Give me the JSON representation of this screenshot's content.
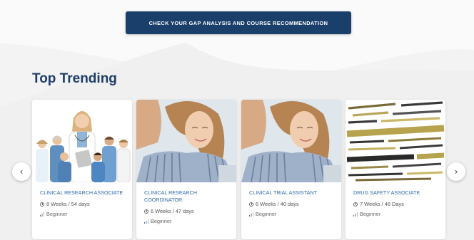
{
  "cta": {
    "label": "CHECK YOUR GAP ANALYSIS AND COURSE RECOMMENDATION"
  },
  "section": {
    "title": "Top Trending"
  },
  "carousel": {
    "prev_icon": "‹",
    "next_icon": "›",
    "courses": [
      {
        "title": "CLINICAL RESEARCH ASSOCIATE",
        "duration": "8 Weeks / 54 days",
        "level": "Beginner",
        "image": "medical-team-photo"
      },
      {
        "title": "CLINICAL RESEARCH COORDINATOR",
        "duration": "6 Weeks / 47 days",
        "level": "Beginner",
        "image": "woman-at-laptop-photo"
      },
      {
        "title": "CLINICAL TRIAL ASSISTANT",
        "duration": "6 Weeks / 40 days",
        "level": "Beginner",
        "image": "woman-at-laptop-photo"
      },
      {
        "title": "DRUG SAFETY ASSOCIATE",
        "duration": "7 Weeks / 46 Days",
        "level": "Beginner",
        "image": "pharmacovigilance-word-cloud"
      }
    ]
  },
  "colors": {
    "accent": "#1b3f6b",
    "link": "#2e6aa8",
    "title": "#1e3d6b"
  }
}
